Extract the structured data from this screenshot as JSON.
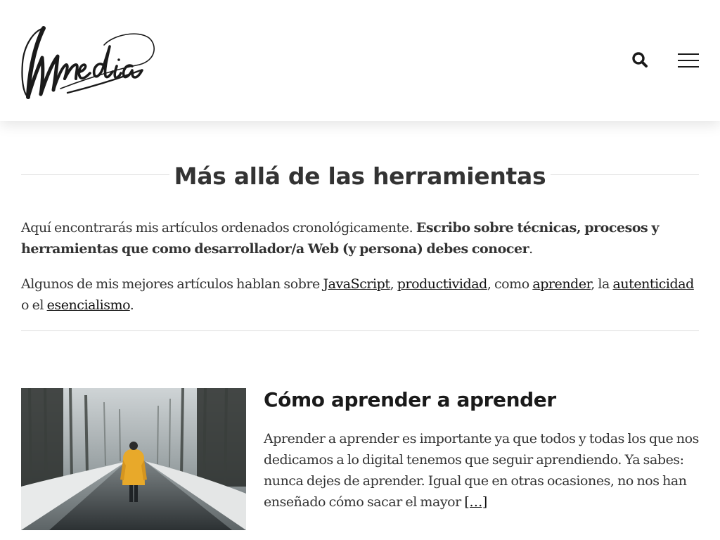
{
  "header": {
    "logo_alt": "Wmedia",
    "search_icon": "search-icon",
    "menu_icon": "hamburger-menu-icon"
  },
  "page": {
    "title": "Más allá de las herramientas"
  },
  "intro": {
    "p1_text": "Aquí encontrarás mis artículos ordenados cronológicamente.",
    "p1_bold": "Escribo sobre técnicas, procesos y herramientas que como desarrollador/a Web (y persona) debes conocer",
    "p1_end": ".",
    "p2_start": "Algunos de mis mejores artículos hablan sobre",
    "links": {
      "javascript": "JavaScript",
      "productividad": "productividad",
      "aprender": "aprender",
      "autenticidad": "autenticidad",
      "esencialismo": "esencialismo"
    },
    "sep_comma": ",",
    "sep_como": ", como",
    "sep_la": ", la",
    "sep_oel": "o el",
    "p2_end": "."
  },
  "articles": [
    {
      "title": "Cómo aprender a aprender",
      "excerpt": " Aprender a aprender es importante ya que todos y todas los que nos dedicamos a lo digital tenemos que seguir aprendiendo. Ya sabes: nunca dejes de aprender. Igual que en otras ocasiones, no nos han enseñado cómo sacar el mayor",
      "read_more": "[…]",
      "image": "person-in-yellow-jacket-on-snowy-forest-road"
    }
  ],
  "colors": {
    "text": "#333333",
    "heading": "#1a1a1a",
    "rule": "#e2e2e2",
    "jacket": "#e8a92a"
  }
}
